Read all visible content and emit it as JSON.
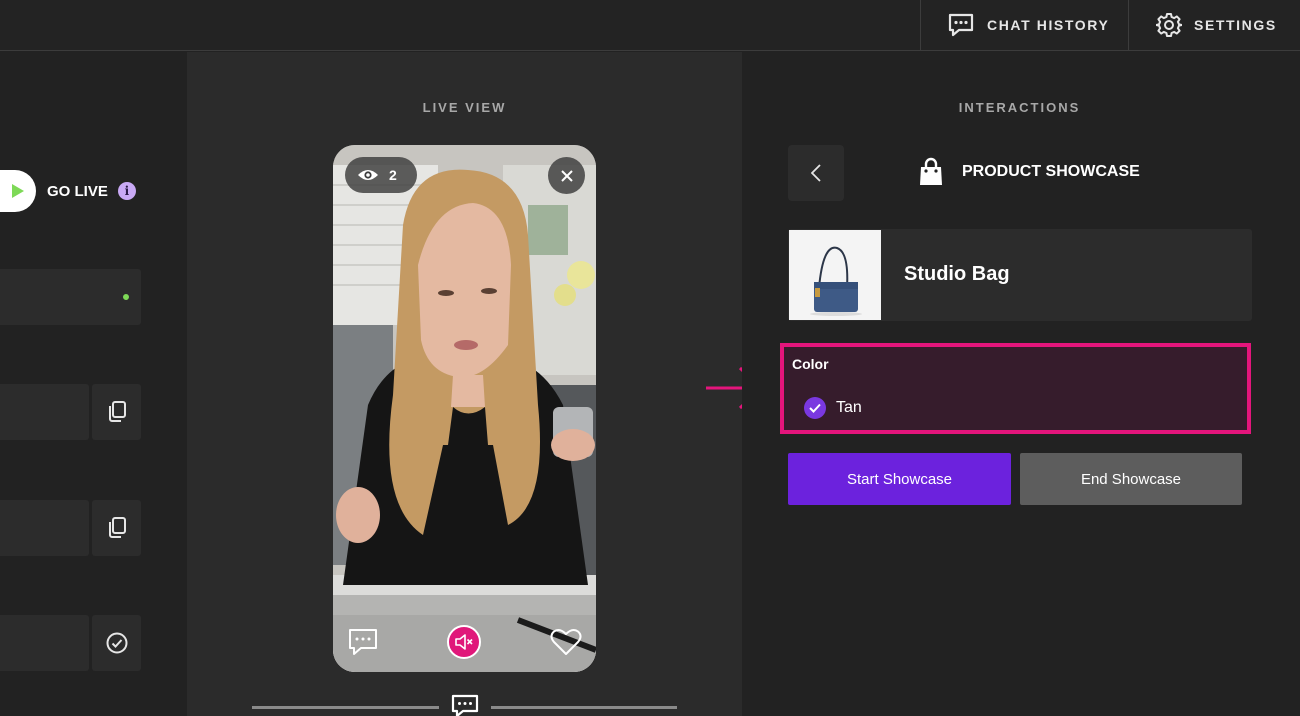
{
  "header": {
    "chat_history_label": "CHAT HISTORY",
    "settings_label": "SETTINGS"
  },
  "sidebar": {
    "go_live_label": "GO LIVE",
    "info_icon": "i",
    "status_color": "#7ed957"
  },
  "live_view": {
    "heading": "LIVE VIEW",
    "viewer_count": "2"
  },
  "interactions": {
    "heading": "INTERACTIONS",
    "section_title": "PRODUCT SHOWCASE",
    "product_name": "Studio Bag",
    "color_label": "Color",
    "selected_color": "Tan",
    "start_button": "Start Showcase",
    "end_button": "End Showcase"
  },
  "colors": {
    "accent_purple": "#6c22dd",
    "highlight_pink": "#e4157c"
  }
}
